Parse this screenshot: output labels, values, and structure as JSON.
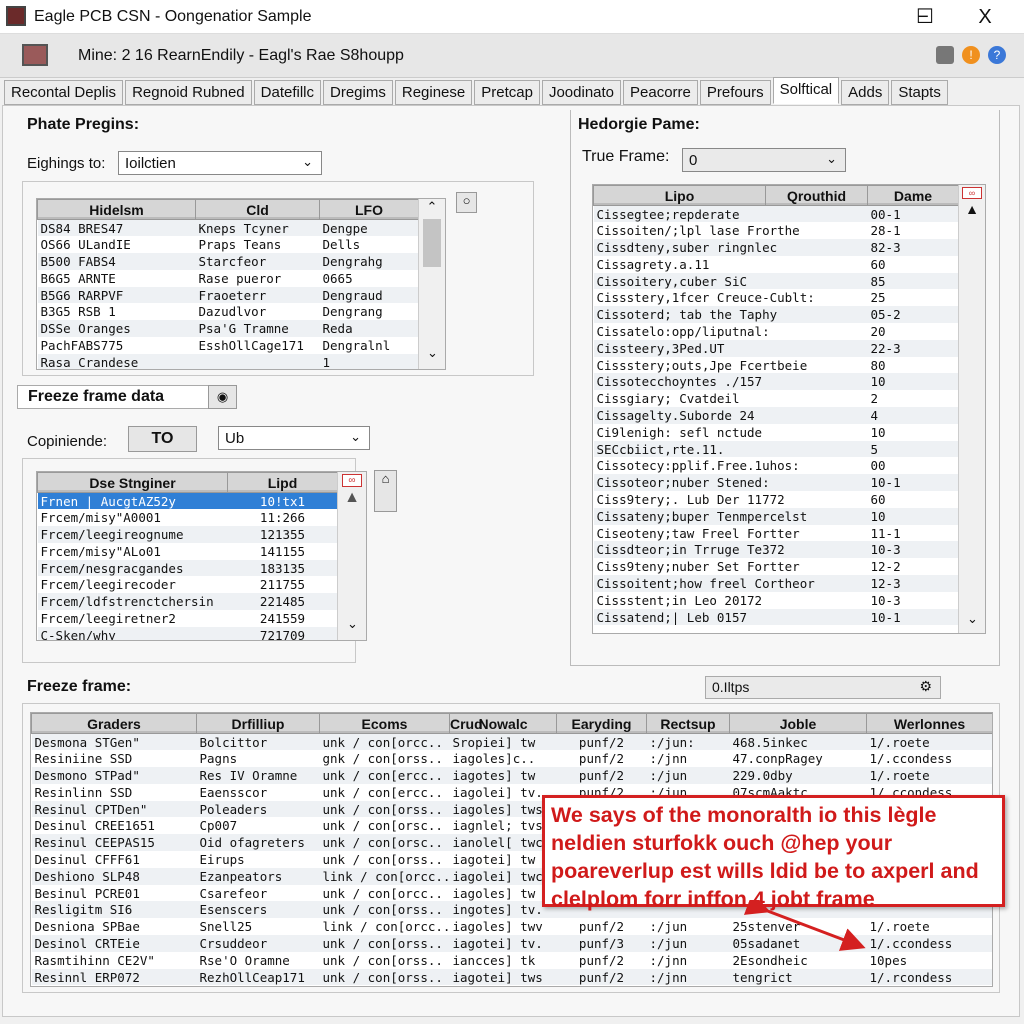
{
  "window": {
    "title": "Eagle PCB CSN - Oongenatior Sample",
    "minimize": "−",
    "maximize": "☐",
    "close": "X"
  },
  "subheader": {
    "title": "Mine: 2 16 RearnEndily - Eagl's Rae S8houpp"
  },
  "tabs": [
    "Recontal Deplis",
    "Regnoid Rubned",
    "Datefillc",
    "Dregims",
    "Reginese",
    "Pretcap",
    "Joodinato",
    "Peacorre",
    "Prefours",
    "Solftical",
    "Adds",
    "Stapts"
  ],
  "active_tab": "Solftical",
  "left": {
    "title": "Phate Pregins:",
    "filter_label": "Eighings to:",
    "filter_value": "Ioilctien",
    "table1": {
      "headers": [
        "Hidelsm",
        "Cld",
        "LFO"
      ],
      "rows": [
        [
          "DS84 BRES47",
          "Kneps Tcyner",
          "Dengpe"
        ],
        [
          "OS66 ULandIE",
          "Praps Teans",
          "Dells"
        ],
        [
          "B500 FABS4",
          "Starcfeor",
          "Dengrahg"
        ],
        [
          "B6G5 ARNTE",
          "Rase pueror",
          "0665"
        ],
        [
          "B5G6 RARPVF",
          "Fraoeterr",
          "Dengraud"
        ],
        [
          "B3G5 RSB 1",
          "Dazudlvor",
          "Dengrang"
        ],
        [
          "DSSe Oranges",
          "Psa'G Tramne",
          "Reda"
        ],
        [
          "PachFABS775",
          "EsshOllCage171",
          "Dengralnl"
        ],
        [
          "Rasa Crandese",
          "",
          "1"
        ]
      ]
    },
    "freeze_label": "Freeze frame data",
    "copy_label": "Copiniende:",
    "to_button": "TO",
    "copy_value": "Ub",
    "table2": {
      "headers": [
        "Dse Stnginer",
        "Lipd"
      ],
      "rows": [
        [
          "Frnen | AucgtAZ52y",
          "10!tx1"
        ],
        [
          "Frcem/misy\"A0001",
          "11:266"
        ],
        [
          "Frcem/leegireognume",
          "121355"
        ],
        [
          "Frcem/misy\"ALo01",
          "141155"
        ],
        [
          "Frcem/nesgracgandes",
          "183135"
        ],
        [
          "Frcem/leegirecoder",
          "211755"
        ],
        [
          "Frcem/ldfstrenctchersin",
          "221485"
        ],
        [
          "Frcem/leegiretner2",
          "241559"
        ],
        [
          "C-Sken/why",
          "721709"
        ]
      ]
    }
  },
  "right": {
    "title": "Hedorgie Pame:",
    "frame_label": "True Frame:",
    "frame_value": "0",
    "table": {
      "headers": [
        "Lipo",
        "Qrouthid",
        "Dame"
      ],
      "rows": [
        [
          "Cissegtee;repderate",
          "00-1"
        ],
        [
          "Cissoiten/;lpl lase Frorthe",
          "28-1"
        ],
        [
          "Cissdteny,suber ringnlec",
          "82-3"
        ],
        [
          "Cissagrety.a.11",
          "60"
        ],
        [
          "Cissoitery,cuber SiC",
          "85"
        ],
        [
          "Cissstery,1fcer Creuce-Cublt:",
          "25"
        ],
        [
          "Cissoterd;  tab the Taphy",
          "05-2"
        ],
        [
          "Cissatelo:opp/liputnal:",
          "20"
        ],
        [
          "Cissteery,3Ped.UT",
          "22-3"
        ],
        [
          "Cissstery;outs,Jpe Fcertbeie",
          "80"
        ],
        [
          "Cissotecchoyntes ./157",
          "10"
        ],
        [
          "Cissgiary; Cvatdeil",
          "2"
        ],
        [
          "Cissagelty.Suborde 24",
          "4"
        ],
        [
          "Ci9lenigh: sefl nctude",
          "10"
        ],
        [
          "SECcbiict,rte.11.",
          "5"
        ],
        [
          "Cissotecy:pplif.Free.1uhos:",
          "00"
        ],
        [
          "Cissoteor;nuber Stened:",
          "10-1"
        ],
        [
          "Ciss9tery;. Lub Der 11772",
          "60"
        ],
        [
          "Cissateny;buper Tenmpercelst",
          "10"
        ],
        [
          "Ciseoteny;taw Freel Fortter",
          "11-1"
        ],
        [
          "Cissdteor;in Trruge Te372",
          "10-3"
        ],
        [
          "Ciss9teny;nuber Set Fortter",
          "12-2"
        ],
        [
          "Cissoitent;how freel Cortheor",
          "12-3"
        ],
        [
          "Cissstent;in Leo 20172",
          "10-3"
        ],
        [
          "Cissatend;| Leb 0157",
          "10-1"
        ]
      ]
    }
  },
  "bottom": {
    "title": "Freeze frame:",
    "search_value": "0.Iltps",
    "table": {
      "headers": [
        "Graders",
        "Drfilliup",
        "Ecoms",
        "Crud",
        "Nowalc",
        "Earyding",
        "Rectsup",
        "Joble",
        "Werlonnes"
      ],
      "rows": [
        [
          "Desmona STGen\"",
          "Bolcittor",
          "unk / con[orcc..",
          "",
          "Sropiei] tw",
          "punf/2",
          ":/jun:",
          "468.5inkec",
          "1/.roete"
        ],
        [
          "Resiniine SSD",
          "Pagns",
          "gnk / con[orss..",
          "",
          "iagoles]c..",
          "punf/2",
          ":/jnn",
          "47.conpRagey",
          "1/.ccondess"
        ],
        [
          "Desmono STPad\"",
          "Res IV Oramne",
          "unk / con[ercc..",
          "",
          "iagotes] tw",
          "punf/2",
          ":/jun",
          "229.0dby",
          "1/.roete"
        ],
        [
          "Resinlinn SSD",
          "Eaensscor",
          "unk / con[ercc..",
          "",
          "iagolei] tv..",
          "punf/2",
          ":/jun",
          "07scmAaktc",
          "1/.ccondess"
        ],
        [
          "Resinul CPTDen\"",
          "Poleaders",
          "unk / con[orss..",
          "",
          "iagoles] tws",
          "",
          "",
          "",
          ""
        ],
        [
          "Desinul CREE1651",
          "Cp007",
          "unk / con[orsc..",
          "",
          "iagnlel; tvs",
          "",
          "",
          "",
          ""
        ],
        [
          "Resinul CEEPAS15",
          "Oid ofagreters",
          "unk / con[orsc..",
          "",
          "ianolel[ twc",
          "",
          "",
          "",
          ""
        ],
        [
          "Desinul CFFF61",
          "Eirups",
          "unk / con[orss..",
          "",
          "iagotei] tw",
          "",
          "",
          "",
          ""
        ],
        [
          "Deshiono SLP48",
          "Ezanpeators",
          "link / con[orcc..",
          "",
          "iagolei] twc",
          "",
          "",
          "",
          ""
        ],
        [
          "Besinul PCRE01",
          "Csarefeor",
          "unk / con[orcc..",
          "",
          "iagoles] tw",
          "",
          "",
          "",
          ""
        ],
        [
          "Resligitm SI6",
          "Esenscers",
          "unk / con[orss..",
          "",
          "ingotes] tv.",
          "",
          "",
          "",
          ""
        ],
        [
          "Desniona SPBae",
          "Snell25",
          "link / con[orcc..",
          "",
          "iagoles] twv",
          "punf/2",
          ":/jun",
          "25stenver",
          "1/.roete"
        ],
        [
          "Desinol CRTEie",
          "Crsuddeor",
          "unk / con[orss..",
          "",
          "iagotei] tv.",
          "punf/3",
          ":/jun",
          "05sadanet",
          "1/.ccondess"
        ],
        [
          "Rasmtihinn CE2V\"",
          "Rse'O Oramne",
          "unk / con[orss..",
          "",
          "iancces] tk",
          "punf/2",
          ":/jnn",
          "2Esondheic",
          "10pes"
        ],
        [
          "Resinnl ERP072",
          "RezhOllCeap171",
          "unk / con[orss..",
          "",
          "iagotei] tws",
          "punf/2",
          ":/jnn",
          "tengrict",
          "1/.rcondess"
        ]
      ]
    }
  },
  "callout": {
    "text": "We says of the monoralth io this lègle neldien sturfokk ouch @hep your poareverlup est wills ldid be to axperl and clelplom forr inffon 4 jobt frame",
    "color": "#d42020"
  },
  "colors": {
    "selection": "#2f7fd6",
    "accent_red": "#d42020"
  }
}
